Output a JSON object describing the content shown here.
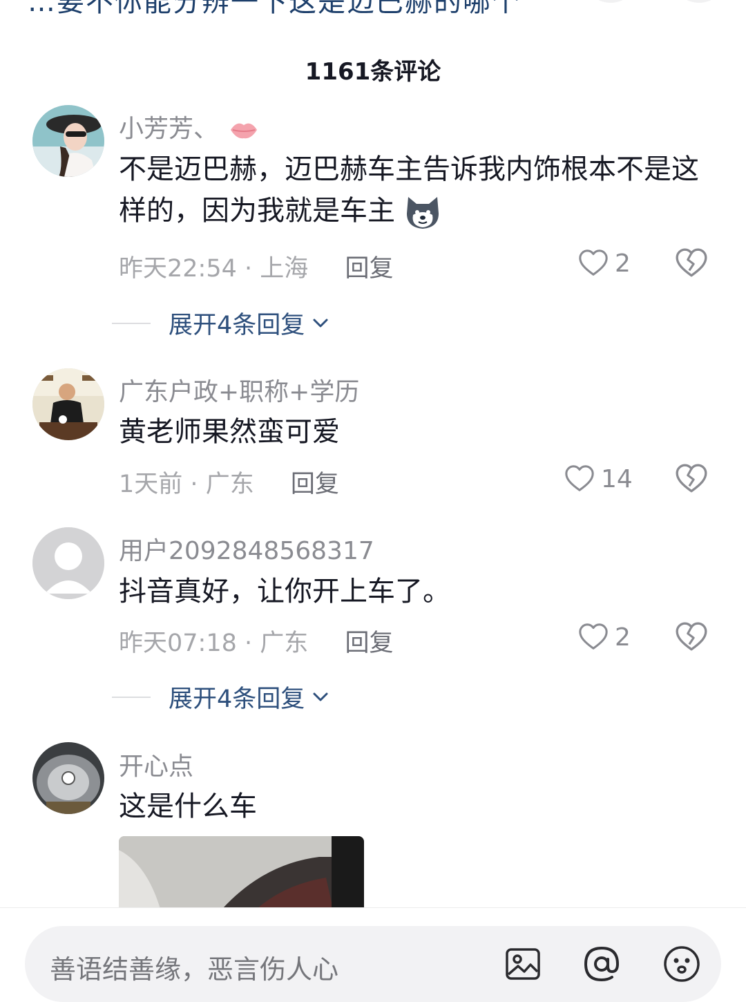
{
  "header": {
    "partial_top_text": "…要不你能分辨一下这是迈巴赫的哪个",
    "comment_count_title": "1161条评论"
  },
  "comments": [
    {
      "username": "小芳芳、",
      "content": "不是迈巴赫，迈巴赫车主告诉我内饰根本不是这样的，因为我就是车主",
      "time": "昨天22:54",
      "location": "上海",
      "reply_label": "回复",
      "likes": "2",
      "expand_label": "展开4条回复"
    },
    {
      "username": "广东户政+职称+学历",
      "content": "黄老师果然蛮可爱",
      "time": "1天前",
      "location": "广东",
      "reply_label": "回复",
      "likes": "14"
    },
    {
      "username": "用户2092848568317",
      "content": "抖音真好，让你开上车了。",
      "time": "昨天07:18",
      "location": "广东",
      "reply_label": "回复",
      "likes": "2",
      "expand_label": "展开4条回复"
    },
    {
      "username": "开心点",
      "content": "这是什么车"
    }
  ],
  "input": {
    "placeholder": "善语结善缘，恶言伤人心"
  },
  "icons": {
    "like": "heart-outline-icon",
    "dislike": "broken-heart-icon",
    "expand": "chevron-down-icon",
    "image": "image-icon",
    "mention": "at-mention-icon",
    "emoji": "emoji-smile-icon",
    "lips_emoji": "lips-emoji",
    "dog_emoji": "dog-face-emoji"
  },
  "colors": {
    "link_blue": "#2d4f7c",
    "secondary_gray": "#8a8b91",
    "text_dark": "#161823"
  }
}
